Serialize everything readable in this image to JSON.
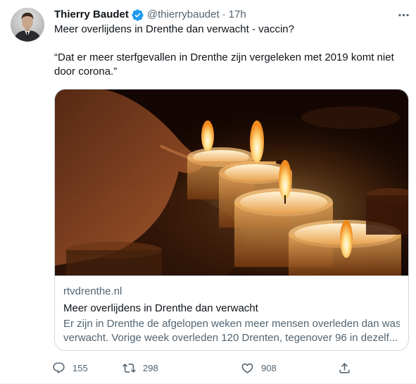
{
  "tweet": {
    "author_name": "Thierry Baudet",
    "handle": "@thierrybaudet",
    "separator": "·",
    "time": "17h",
    "text_line1": "Meer overlijdens in Drenthe dan verwacht - vaccin?",
    "text_line2": "“Dat er meer sterfgevallen in Drenthe zijn vergeleken met 2019 komt niet",
    "text_line3": "door corona.”"
  },
  "card": {
    "domain": "rtvdrenthe.nl",
    "title": "Meer overlijdens in Drenthe dan verwacht",
    "description_line1": "Er zijn in Drenthe de afgelopen weken meer mensen overleden dan was",
    "description_line2": "verwacht. Vorige week overleden 120 Drenten, tegenover 96 in dezelf..."
  },
  "actions": {
    "reply_count": "155",
    "retweet_count": "298",
    "like_count": "908"
  },
  "icons": {
    "verified": "verified-badge-icon",
    "more": "more-options-icon",
    "reply": "reply-icon",
    "retweet": "retweet-icon",
    "like": "heart-icon",
    "share": "share-icon"
  },
  "colors": {
    "verified_blue": "#1d9bf0",
    "muted_text": "#536471",
    "primary_text": "#0f1419",
    "card_border": "#cfd9de"
  }
}
